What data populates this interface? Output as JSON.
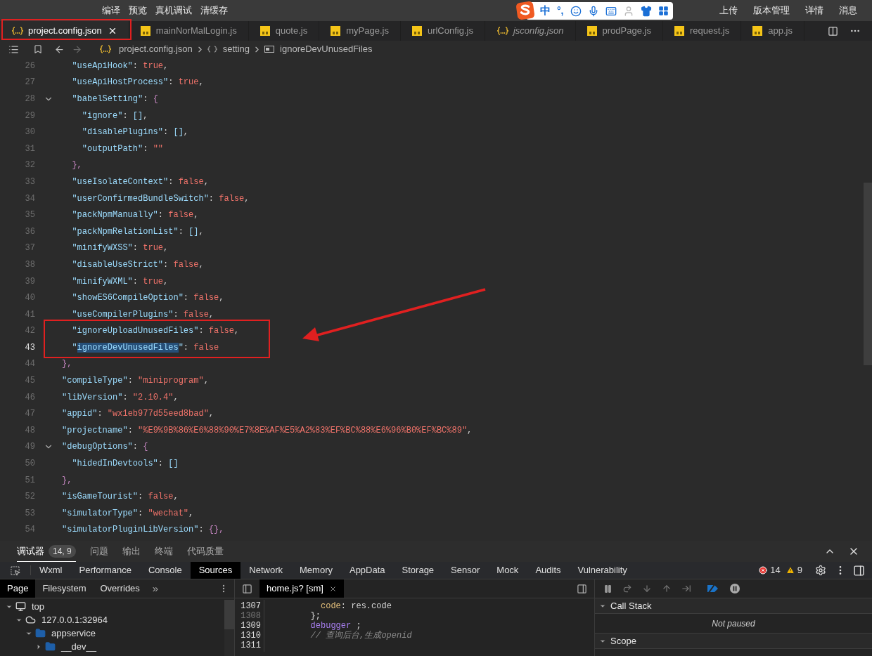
{
  "toolbar": {
    "left": [
      "编译",
      "预览",
      "真机调试",
      "清缓存"
    ],
    "right": [
      "上传",
      "版本管理",
      "详情",
      "消息"
    ]
  },
  "ime_toolbar": {
    "mode": "中",
    "punct": "°,"
  },
  "tabs": [
    {
      "label": "project.config.json",
      "kind": "json",
      "selected": true,
      "preview": false,
      "marked": true
    },
    {
      "label": "mainNorMalLogin.js",
      "kind": "js",
      "selected": false,
      "preview": false,
      "marked": false
    },
    {
      "label": "quote.js",
      "kind": "js",
      "selected": false,
      "preview": false,
      "marked": false
    },
    {
      "label": "myPage.js",
      "kind": "js",
      "selected": false,
      "preview": false,
      "marked": false
    },
    {
      "label": "urlConfig.js",
      "kind": "js",
      "selected": false,
      "preview": false,
      "marked": false
    },
    {
      "label": "jsconfig.json",
      "kind": "json",
      "selected": false,
      "preview": true,
      "marked": false
    },
    {
      "label": "prodPage.js",
      "kind": "js",
      "selected": false,
      "preview": false,
      "marked": false
    },
    {
      "label": "request.js",
      "kind": "js",
      "selected": false,
      "preview": false,
      "marked": false
    },
    {
      "label": "app.js",
      "kind": "js",
      "selected": false,
      "preview": false,
      "marked": false
    }
  ],
  "breadcrumb": [
    {
      "kind": "file",
      "label": "project.config.json"
    },
    {
      "kind": "object",
      "label": "setting"
    },
    {
      "kind": "field",
      "label": "ignoreDevUnusedFiles"
    }
  ],
  "lines": [
    {
      "number": "26",
      "active": false,
      "fold": false,
      "marked": false,
      "tokens": [
        {
          "kind": "key",
          "text": "  \"useApiHook\""
        },
        {
          "kind": "punct",
          "text": ": "
        },
        {
          "kind": "literal",
          "text": "true"
        },
        {
          "kind": "punct",
          "text": ","
        }
      ]
    },
    {
      "number": "27",
      "active": false,
      "fold": false,
      "marked": false,
      "tokens": [
        {
          "kind": "key",
          "text": "  \"useApiHostProcess\""
        },
        {
          "kind": "punct",
          "text": ": "
        },
        {
          "kind": "literal",
          "text": "true"
        },
        {
          "kind": "punct",
          "text": ","
        }
      ]
    },
    {
      "number": "28",
      "active": false,
      "fold": true,
      "marked": false,
      "tokens": [
        {
          "kind": "key",
          "text": "  \"babelSetting\""
        },
        {
          "kind": "punct",
          "text": ": "
        },
        {
          "kind": "brace",
          "text": "{"
        }
      ]
    },
    {
      "number": "29",
      "active": false,
      "fold": false,
      "marked": false,
      "tokens": [
        {
          "kind": "key",
          "text": "    \"ignore\""
        },
        {
          "kind": "punct",
          "text": ": "
        },
        {
          "kind": "bracket",
          "text": "[]"
        },
        {
          "kind": "punct",
          "text": ","
        }
      ]
    },
    {
      "number": "30",
      "active": false,
      "fold": false,
      "marked": false,
      "tokens": [
        {
          "kind": "key",
          "text": "    \"disablePlugins\""
        },
        {
          "kind": "punct",
          "text": ": "
        },
        {
          "kind": "bracket",
          "text": "[]"
        },
        {
          "kind": "punct",
          "text": ","
        }
      ]
    },
    {
      "number": "31",
      "active": false,
      "fold": false,
      "marked": false,
      "tokens": [
        {
          "kind": "key",
          "text": "    \"outputPath\""
        },
        {
          "kind": "punct",
          "text": ": "
        },
        {
          "kind": "string",
          "text": "\"\""
        }
      ]
    },
    {
      "number": "32",
      "active": false,
      "fold": false,
      "marked": false,
      "tokens": [
        {
          "kind": "brace",
          "text": "  },"
        }
      ]
    },
    {
      "number": "33",
      "active": false,
      "fold": false,
      "marked": false,
      "tokens": [
        {
          "kind": "key",
          "text": "  \"useIsolateContext\""
        },
        {
          "kind": "punct",
          "text": ": "
        },
        {
          "kind": "literal",
          "text": "false"
        },
        {
          "kind": "punct",
          "text": ","
        }
      ]
    },
    {
      "number": "34",
      "active": false,
      "fold": false,
      "marked": false,
      "tokens": [
        {
          "kind": "key",
          "text": "  \"userConfirmedBundleSwitch\""
        },
        {
          "kind": "punct",
          "text": ": "
        },
        {
          "kind": "literal",
          "text": "false"
        },
        {
          "kind": "punct",
          "text": ","
        }
      ]
    },
    {
      "number": "35",
      "active": false,
      "fold": false,
      "marked": false,
      "tokens": [
        {
          "kind": "key",
          "text": "  \"packNpmManually\""
        },
        {
          "kind": "punct",
          "text": ": "
        },
        {
          "kind": "literal",
          "text": "false"
        },
        {
          "kind": "punct",
          "text": ","
        }
      ]
    },
    {
      "number": "36",
      "active": false,
      "fold": false,
      "marked": false,
      "tokens": [
        {
          "kind": "key",
          "text": "  \"packNpmRelationList\""
        },
        {
          "kind": "punct",
          "text": ": "
        },
        {
          "kind": "bracket",
          "text": "[]"
        },
        {
          "kind": "punct",
          "text": ","
        }
      ]
    },
    {
      "number": "37",
      "active": false,
      "fold": false,
      "marked": false,
      "tokens": [
        {
          "kind": "key",
          "text": "  \"minifyWXSS\""
        },
        {
          "kind": "punct",
          "text": ": "
        },
        {
          "kind": "literal",
          "text": "true"
        },
        {
          "kind": "punct",
          "text": ","
        }
      ]
    },
    {
      "number": "38",
      "active": false,
      "fold": false,
      "marked": false,
      "tokens": [
        {
          "kind": "key",
          "text": "  \"disableUseStrict\""
        },
        {
          "kind": "punct",
          "text": ": "
        },
        {
          "kind": "literal",
          "text": "false"
        },
        {
          "kind": "punct",
          "text": ","
        }
      ]
    },
    {
      "number": "39",
      "active": false,
      "fold": false,
      "marked": false,
      "tokens": [
        {
          "kind": "key",
          "text": "  \"minifyWXML\""
        },
        {
          "kind": "punct",
          "text": ": "
        },
        {
          "kind": "literal",
          "text": "true"
        },
        {
          "kind": "punct",
          "text": ","
        }
      ]
    },
    {
      "number": "40",
      "active": false,
      "fold": false,
      "marked": false,
      "tokens": [
        {
          "kind": "key",
          "text": "  \"showES6CompileOption\""
        },
        {
          "kind": "punct",
          "text": ": "
        },
        {
          "kind": "literal",
          "text": "false"
        },
        {
          "kind": "punct",
          "text": ","
        }
      ]
    },
    {
      "number": "41",
      "active": false,
      "fold": false,
      "marked": false,
      "tokens": [
        {
          "kind": "key",
          "text": "  \"useCompilerPlugins\""
        },
        {
          "kind": "punct",
          "text": ": "
        },
        {
          "kind": "literal",
          "text": "false"
        },
        {
          "kind": "punct",
          "text": ","
        }
      ]
    },
    {
      "number": "42",
      "active": false,
      "fold": false,
      "marked": true,
      "tokens": [
        {
          "kind": "key",
          "text": "  \"ignoreUploadUnusedFiles\""
        },
        {
          "kind": "punct",
          "text": ": "
        },
        {
          "kind": "literal",
          "text": "false"
        },
        {
          "kind": "punct",
          "text": ","
        }
      ]
    },
    {
      "number": "43",
      "active": true,
      "fold": false,
      "marked": true,
      "tokens": [
        {
          "kind": "key",
          "text": "  \""
        },
        {
          "kind": "selection",
          "text": "ignoreDevUnusedFiles"
        },
        {
          "kind": "key",
          "text": "\""
        },
        {
          "kind": "punct",
          "text": ": "
        },
        {
          "kind": "literal",
          "text": "false"
        }
      ]
    },
    {
      "number": "44",
      "active": false,
      "fold": false,
      "marked": false,
      "tokens": [
        {
          "kind": "brace",
          "text": "},"
        }
      ]
    },
    {
      "number": "45",
      "active": false,
      "fold": false,
      "marked": false,
      "tokens": [
        {
          "kind": "key",
          "text": "\"compileType\""
        },
        {
          "kind": "punct",
          "text": ": "
        },
        {
          "kind": "string",
          "text": "\"miniprogram\""
        },
        {
          "kind": "punct",
          "text": ","
        }
      ]
    },
    {
      "number": "46",
      "active": false,
      "fold": false,
      "marked": false,
      "tokens": [
        {
          "kind": "key",
          "text": "\"libVersion\""
        },
        {
          "kind": "punct",
          "text": ": "
        },
        {
          "kind": "string",
          "text": "\"2.10.4\""
        },
        {
          "kind": "punct",
          "text": ","
        }
      ]
    },
    {
      "number": "47",
      "active": false,
      "fold": false,
      "marked": false,
      "tokens": [
        {
          "kind": "key",
          "text": "\"appid\""
        },
        {
          "kind": "punct",
          "text": ": "
        },
        {
          "kind": "string",
          "text": "\"wx1eb977d55eed8bad\""
        },
        {
          "kind": "punct",
          "text": ","
        }
      ]
    },
    {
      "number": "48",
      "active": false,
      "fold": false,
      "marked": false,
      "tokens": [
        {
          "kind": "key",
          "text": "\"projectname\""
        },
        {
          "kind": "punct",
          "text": ": "
        },
        {
          "kind": "string",
          "text": "\"%E9%9B%86%E6%88%90%E7%8E%AF%E5%A2%83%EF%BC%88%E6%96%B0%EF%BC%89\""
        },
        {
          "kind": "punct",
          "text": ","
        }
      ]
    },
    {
      "number": "49",
      "active": false,
      "fold": true,
      "marked": false,
      "tokens": [
        {
          "kind": "key",
          "text": "\"debugOptions\""
        },
        {
          "kind": "punct",
          "text": ": "
        },
        {
          "kind": "brace",
          "text": "{"
        }
      ]
    },
    {
      "number": "50",
      "active": false,
      "fold": false,
      "marked": false,
      "tokens": [
        {
          "kind": "key",
          "text": "  \"hidedInDevtools\""
        },
        {
          "kind": "punct",
          "text": ": "
        },
        {
          "kind": "bracket",
          "text": "[]"
        }
      ]
    },
    {
      "number": "51",
      "active": false,
      "fold": false,
      "marked": false,
      "tokens": [
        {
          "kind": "brace",
          "text": "},"
        }
      ]
    },
    {
      "number": "52",
      "active": false,
      "fold": false,
      "marked": false,
      "tokens": [
        {
          "kind": "key",
          "text": "\"isGameTourist\""
        },
        {
          "kind": "punct",
          "text": ": "
        },
        {
          "kind": "literal",
          "text": "false"
        },
        {
          "kind": "punct",
          "text": ","
        }
      ]
    },
    {
      "number": "53",
      "active": false,
      "fold": false,
      "marked": false,
      "tokens": [
        {
          "kind": "key",
          "text": "\"simulatorType\""
        },
        {
          "kind": "punct",
          "text": ": "
        },
        {
          "kind": "string",
          "text": "\"wechat\""
        },
        {
          "kind": "punct",
          "text": ","
        }
      ]
    },
    {
      "number": "54",
      "active": false,
      "fold": false,
      "marked": false,
      "tokens": [
        {
          "kind": "key",
          "text": "\"simulatorPluginLibVersion\""
        },
        {
          "kind": "punct",
          "text": ": "
        },
        {
          "kind": "brace",
          "text": "{},"
        }
      ]
    }
  ],
  "panel": {
    "tabs": [
      {
        "label": "调试器",
        "selected": true,
        "badge": "14, 9"
      },
      {
        "label": "问题",
        "selected": false
      },
      {
        "label": "输出",
        "selected": false
      },
      {
        "label": "终端",
        "selected": false
      },
      {
        "label": "代码质量",
        "selected": false
      }
    ]
  },
  "devtools": {
    "tabs": [
      {
        "label": "Wxml",
        "selected": false
      },
      {
        "label": "Performance",
        "selected": false
      },
      {
        "label": "Console",
        "selected": false
      },
      {
        "label": "Sources",
        "selected": true
      },
      {
        "label": "Network",
        "selected": false
      },
      {
        "label": "Memory",
        "selected": false
      },
      {
        "label": "AppData",
        "selected": false
      },
      {
        "label": "Storage",
        "selected": false
      },
      {
        "label": "Sensor",
        "selected": false
      },
      {
        "label": "Mock",
        "selected": false
      },
      {
        "label": "Audits",
        "selected": false
      },
      {
        "label": "Vulnerability",
        "selected": false
      }
    ],
    "errors": "14",
    "warnings": "9"
  },
  "navigator": {
    "tabs": [
      {
        "label": "Page",
        "selected": true
      },
      {
        "label": "Filesystem",
        "selected": false
      },
      {
        "label": "Overrides",
        "selected": false
      }
    ],
    "more": "»",
    "tree": [
      {
        "label": "top",
        "kind": "frame",
        "expanded": true,
        "children": [
          {
            "label": "127.0.0.1:32964",
            "kind": "cloud",
            "expanded": true,
            "children": [
              {
                "label": "appservice",
                "kind": "folder",
                "expanded": true,
                "children": [
                  {
                    "label": "__dev__",
                    "kind": "folder",
                    "expanded": false
                  }
                ]
              }
            ]
          }
        ]
      }
    ]
  },
  "source": {
    "file_tab": "home.js? [sm]",
    "lines": [
      {
        "number": "1307",
        "active": false,
        "tokens": [
          {
            "kind": "prop",
            "text": "          code"
          },
          {
            "kind": "plain",
            "text": ": res.code"
          }
        ]
      },
      {
        "number": "1308",
        "active": true,
        "tokens": [
          {
            "kind": "plain",
            "text": "        };"
          }
        ]
      },
      {
        "number": "1309",
        "active": false,
        "tokens": [
          {
            "kind": "keyword",
            "text": "        debugger"
          },
          {
            "kind": "plain",
            "text": " ;"
          }
        ]
      },
      {
        "number": "1310",
        "active": false,
        "tokens": [
          {
            "kind": "comment",
            "text": "        // 查询后台,生成openid"
          }
        ]
      },
      {
        "number": "1311",
        "active": false
      }
    ]
  },
  "debugger": {
    "sections": [
      {
        "title": "Call Stack",
        "expanded": true,
        "message": "Not paused"
      },
      {
        "title": "Scope",
        "expanded": true
      }
    ]
  }
}
